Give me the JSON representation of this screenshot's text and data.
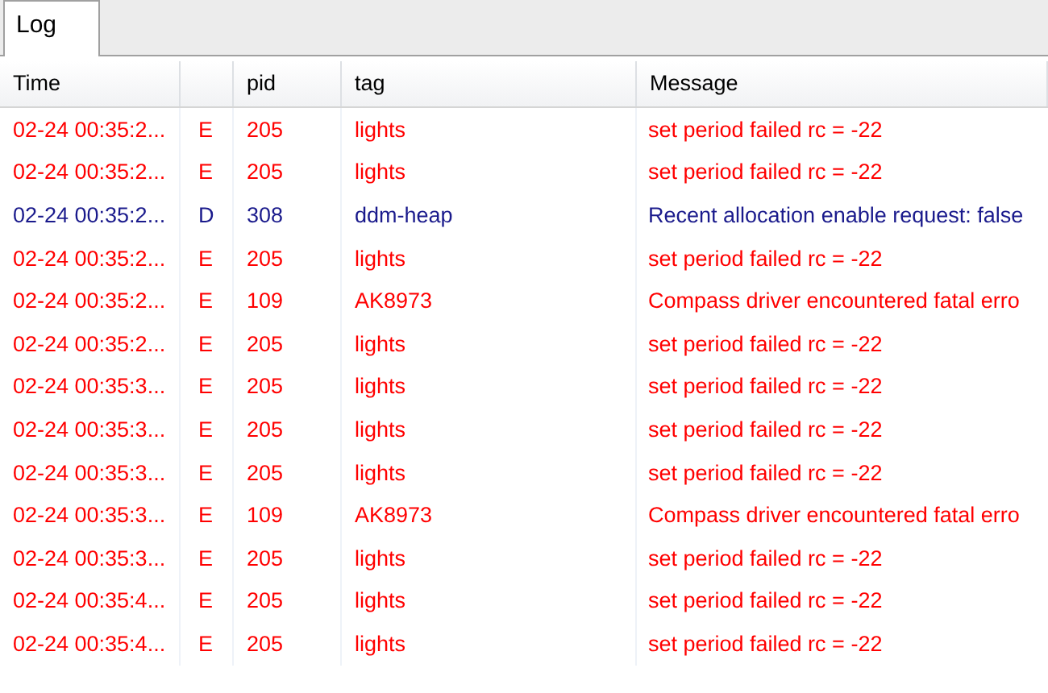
{
  "tabs": [
    {
      "label": "Log",
      "selected": true
    }
  ],
  "table": {
    "columns": [
      "Time",
      "",
      "pid",
      "tag",
      "Message"
    ],
    "rows": [
      {
        "kind": "error",
        "time": "02-24 00:35:2...",
        "level_code": "E",
        "pid": "205",
        "tag": "lights",
        "message": "set period failed rc = -22"
      },
      {
        "kind": "error",
        "time": "02-24 00:35:2...",
        "level_code": "E",
        "pid": "205",
        "tag": "lights",
        "message": "set period failed rc = -22"
      },
      {
        "kind": "debug",
        "time": "02-24 00:35:2...",
        "level_code": "D",
        "pid": "308",
        "tag": "ddm-heap",
        "message": "Recent allocation enable request: false"
      },
      {
        "kind": "error",
        "time": "02-24 00:35:2...",
        "level_code": "E",
        "pid": "205",
        "tag": "lights",
        "message": "set period failed rc = -22"
      },
      {
        "kind": "error",
        "time": "02-24 00:35:2...",
        "level_code": "E",
        "pid": "109",
        "tag": "AK8973",
        "message": "Compass driver encountered fatal erro"
      },
      {
        "kind": "error",
        "time": "02-24 00:35:2...",
        "level_code": "E",
        "pid": "205",
        "tag": "lights",
        "message": "set period failed rc = -22"
      },
      {
        "kind": "error",
        "time": "02-24 00:35:3...",
        "level_code": "E",
        "pid": "205",
        "tag": "lights",
        "message": "set period failed rc = -22"
      },
      {
        "kind": "error",
        "time": "02-24 00:35:3...",
        "level_code": "E",
        "pid": "205",
        "tag": "lights",
        "message": "set period failed rc = -22"
      },
      {
        "kind": "error",
        "time": "02-24 00:35:3...",
        "level_code": "E",
        "pid": "205",
        "tag": "lights",
        "message": "set period failed rc = -22"
      },
      {
        "kind": "error",
        "time": "02-24 00:35:3...",
        "level_code": "E",
        "pid": "109",
        "tag": "AK8973",
        "message": "Compass driver encountered fatal erro"
      },
      {
        "kind": "error",
        "time": "02-24 00:35:3...",
        "level_code": "E",
        "pid": "205",
        "tag": "lights",
        "message": "set period failed rc = -22"
      },
      {
        "kind": "error",
        "time": "02-24 00:35:4...",
        "level_code": "E",
        "pid": "205",
        "tag": "lights",
        "message": "set period failed rc = -22"
      },
      {
        "kind": "error",
        "time": "02-24 00:35:4...",
        "level_code": "E",
        "pid": "205",
        "tag": "lights",
        "message": "set period failed rc = -22"
      }
    ]
  }
}
